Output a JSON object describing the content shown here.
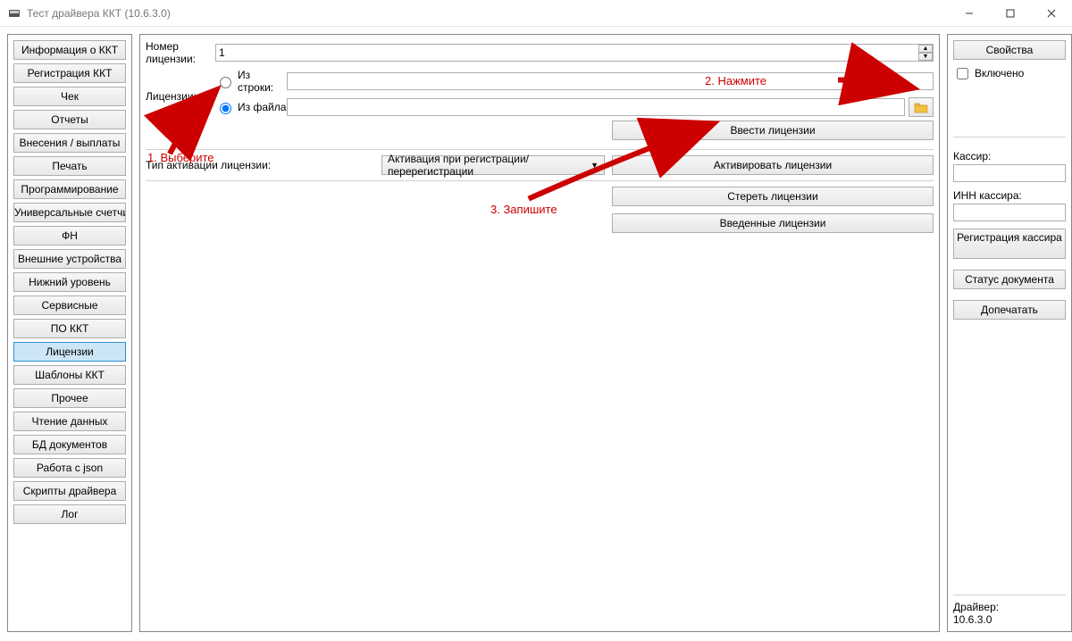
{
  "window": {
    "title": "Тест драйвера ККТ (10.6.3.0)"
  },
  "sidebar": {
    "items": [
      {
        "id": "info",
        "label": "Информация о ККТ"
      },
      {
        "id": "reg",
        "label": "Регистрация ККТ"
      },
      {
        "id": "check",
        "label": "Чек"
      },
      {
        "id": "reports",
        "label": "Отчеты"
      },
      {
        "id": "payments",
        "label": "Внесения / выплаты"
      },
      {
        "id": "print",
        "label": "Печать"
      },
      {
        "id": "prog",
        "label": "Программирование"
      },
      {
        "id": "counters",
        "label": "Универсальные счетчики"
      },
      {
        "id": "fn",
        "label": "ФН"
      },
      {
        "id": "ext",
        "label": "Внешние устройства"
      },
      {
        "id": "lower",
        "label": "Нижний уровень"
      },
      {
        "id": "service",
        "label": "Сервисные"
      },
      {
        "id": "pokt",
        "label": "ПО ККТ"
      },
      {
        "id": "licenses",
        "label": "Лицензии",
        "active": true
      },
      {
        "id": "templates",
        "label": "Шаблоны ККТ"
      },
      {
        "id": "other",
        "label": "Прочее"
      },
      {
        "id": "read",
        "label": "Чтение данных"
      },
      {
        "id": "db",
        "label": "БД документов"
      },
      {
        "id": "json",
        "label": "Работа с json"
      },
      {
        "id": "scripts",
        "label": "Скрипты драйвера"
      },
      {
        "id": "log",
        "label": "Лог"
      }
    ]
  },
  "center": {
    "license_number_label": "Номер лицензии:",
    "license_number_value": "1",
    "licenses_label": "Лицензии:",
    "radio_string": "Из строки:",
    "radio_file": "Из файла",
    "string_value": "",
    "file_value": "",
    "activation_type_label": "Тип активации лицензии:",
    "activation_type_value": "Активация при регистрации/перерегистрации",
    "buttons": {
      "enter": "Ввести лицензии",
      "activate": "Активировать лицензии",
      "erase": "Стереть лицензии",
      "entered": "Введенные лицензии"
    }
  },
  "right": {
    "properties": "Свойства",
    "enabled": "Включено",
    "cashier_label": "Кассир:",
    "cashier_value": "",
    "inn_label": "ИНН кассира:",
    "inn_value": "",
    "register_cashier": "Регистрация\nкассира",
    "doc_status": "Статус документа",
    "reprint": "Допечатать",
    "driver_label": "Драйвер:",
    "driver_version": "10.6.3.0"
  },
  "annotations": {
    "a1": "1. Выберите",
    "a2": "2. Нажмите",
    "a3": "3. Запишите"
  }
}
